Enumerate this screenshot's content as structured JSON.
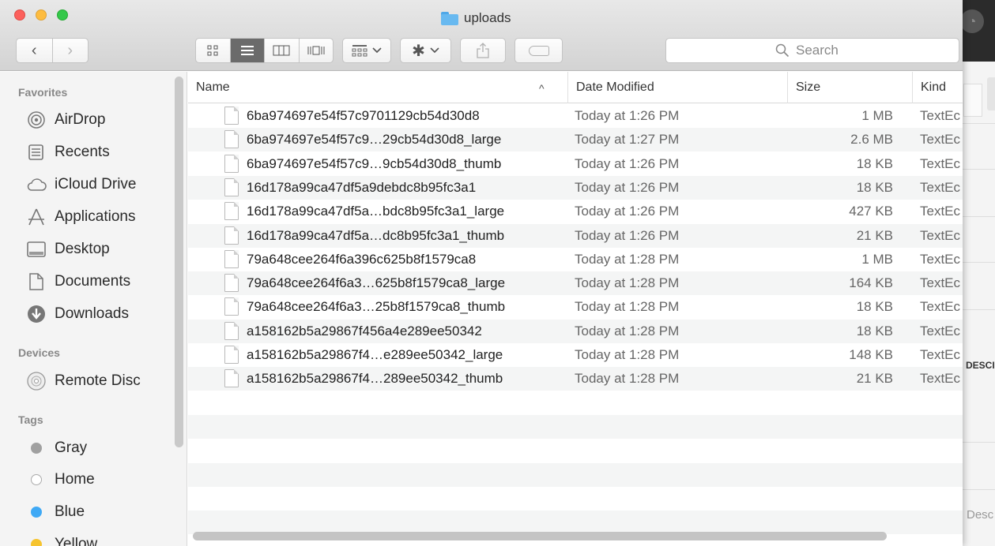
{
  "window": {
    "title": "uploads"
  },
  "toolbar": {
    "nav_back": "‹",
    "nav_forward": "›",
    "search_placeholder": "Search"
  },
  "sidebar": {
    "favorites_heading": "Favorites",
    "favorites": [
      {
        "label": "AirDrop",
        "icon": "airdrop-icon"
      },
      {
        "label": "Recents",
        "icon": "recents-icon"
      },
      {
        "label": "iCloud Drive",
        "icon": "cloud-icon"
      },
      {
        "label": "Applications",
        "icon": "applications-icon"
      },
      {
        "label": "Desktop",
        "icon": "desktop-icon"
      },
      {
        "label": "Documents",
        "icon": "documents-icon"
      },
      {
        "label": "Downloads",
        "icon": "downloads-icon"
      }
    ],
    "devices_heading": "Devices",
    "devices": [
      {
        "label": "Remote Disc",
        "icon": "disc-icon"
      }
    ],
    "tags_heading": "Tags",
    "tags": [
      {
        "label": "Gray",
        "color": "#a0a0a0"
      },
      {
        "label": "Home",
        "color": "#ffffff"
      },
      {
        "label": "Blue",
        "color": "#3fa9f5"
      },
      {
        "label": "Yellow",
        "color": "#f6c42f"
      }
    ]
  },
  "list": {
    "columns": {
      "name": "Name",
      "date": "Date Modified",
      "size": "Size",
      "kind": "Kind"
    },
    "sort_indicator": "^",
    "rows": [
      {
        "name": "6ba974697e54f57c9701129cb54d30d8",
        "date": "Today at 1:26 PM",
        "size": "1 MB",
        "kind": "TextEc"
      },
      {
        "name": "6ba974697e54f57c9…29cb54d30d8_large",
        "date": "Today at 1:27 PM",
        "size": "2.6 MB",
        "kind": "TextEc"
      },
      {
        "name": "6ba974697e54f57c9…9cb54d30d8_thumb",
        "date": "Today at 1:26 PM",
        "size": "18 KB",
        "kind": "TextEc"
      },
      {
        "name": "16d178a99ca47df5a9debdc8b95fc3a1",
        "date": "Today at 1:26 PM",
        "size": "18 KB",
        "kind": "TextEc"
      },
      {
        "name": "16d178a99ca47df5a…bdc8b95fc3a1_large",
        "date": "Today at 1:26 PM",
        "size": "427 KB",
        "kind": "TextEc"
      },
      {
        "name": "16d178a99ca47df5a…dc8b95fc3a1_thumb",
        "date": "Today at 1:26 PM",
        "size": "21 KB",
        "kind": "TextEc"
      },
      {
        "name": "79a648cee264f6a396c625b8f1579ca8",
        "date": "Today at 1:28 PM",
        "size": "1 MB",
        "kind": "TextEc"
      },
      {
        "name": "79a648cee264f6a3…625b8f1579ca8_large",
        "date": "Today at 1:28 PM",
        "size": "164 KB",
        "kind": "TextEc"
      },
      {
        "name": "79a648cee264f6a3…25b8f1579ca8_thumb",
        "date": "Today at 1:28 PM",
        "size": "18 KB",
        "kind": "TextEc"
      },
      {
        "name": "a158162b5a29867f456a4e289ee50342",
        "date": "Today at 1:28 PM",
        "size": "18 KB",
        "kind": "TextEc"
      },
      {
        "name": "a158162b5a29867f4…e289ee50342_large",
        "date": "Today at 1:28 PM",
        "size": "148 KB",
        "kind": "TextEc"
      },
      {
        "name": "a158162b5a29867f4…289ee50342_thumb",
        "date": "Today at 1:28 PM",
        "size": "21 KB",
        "kind": "TextEc"
      }
    ]
  },
  "background_app": {
    "label_a": "DESCI",
    "label_b": "Desc"
  }
}
